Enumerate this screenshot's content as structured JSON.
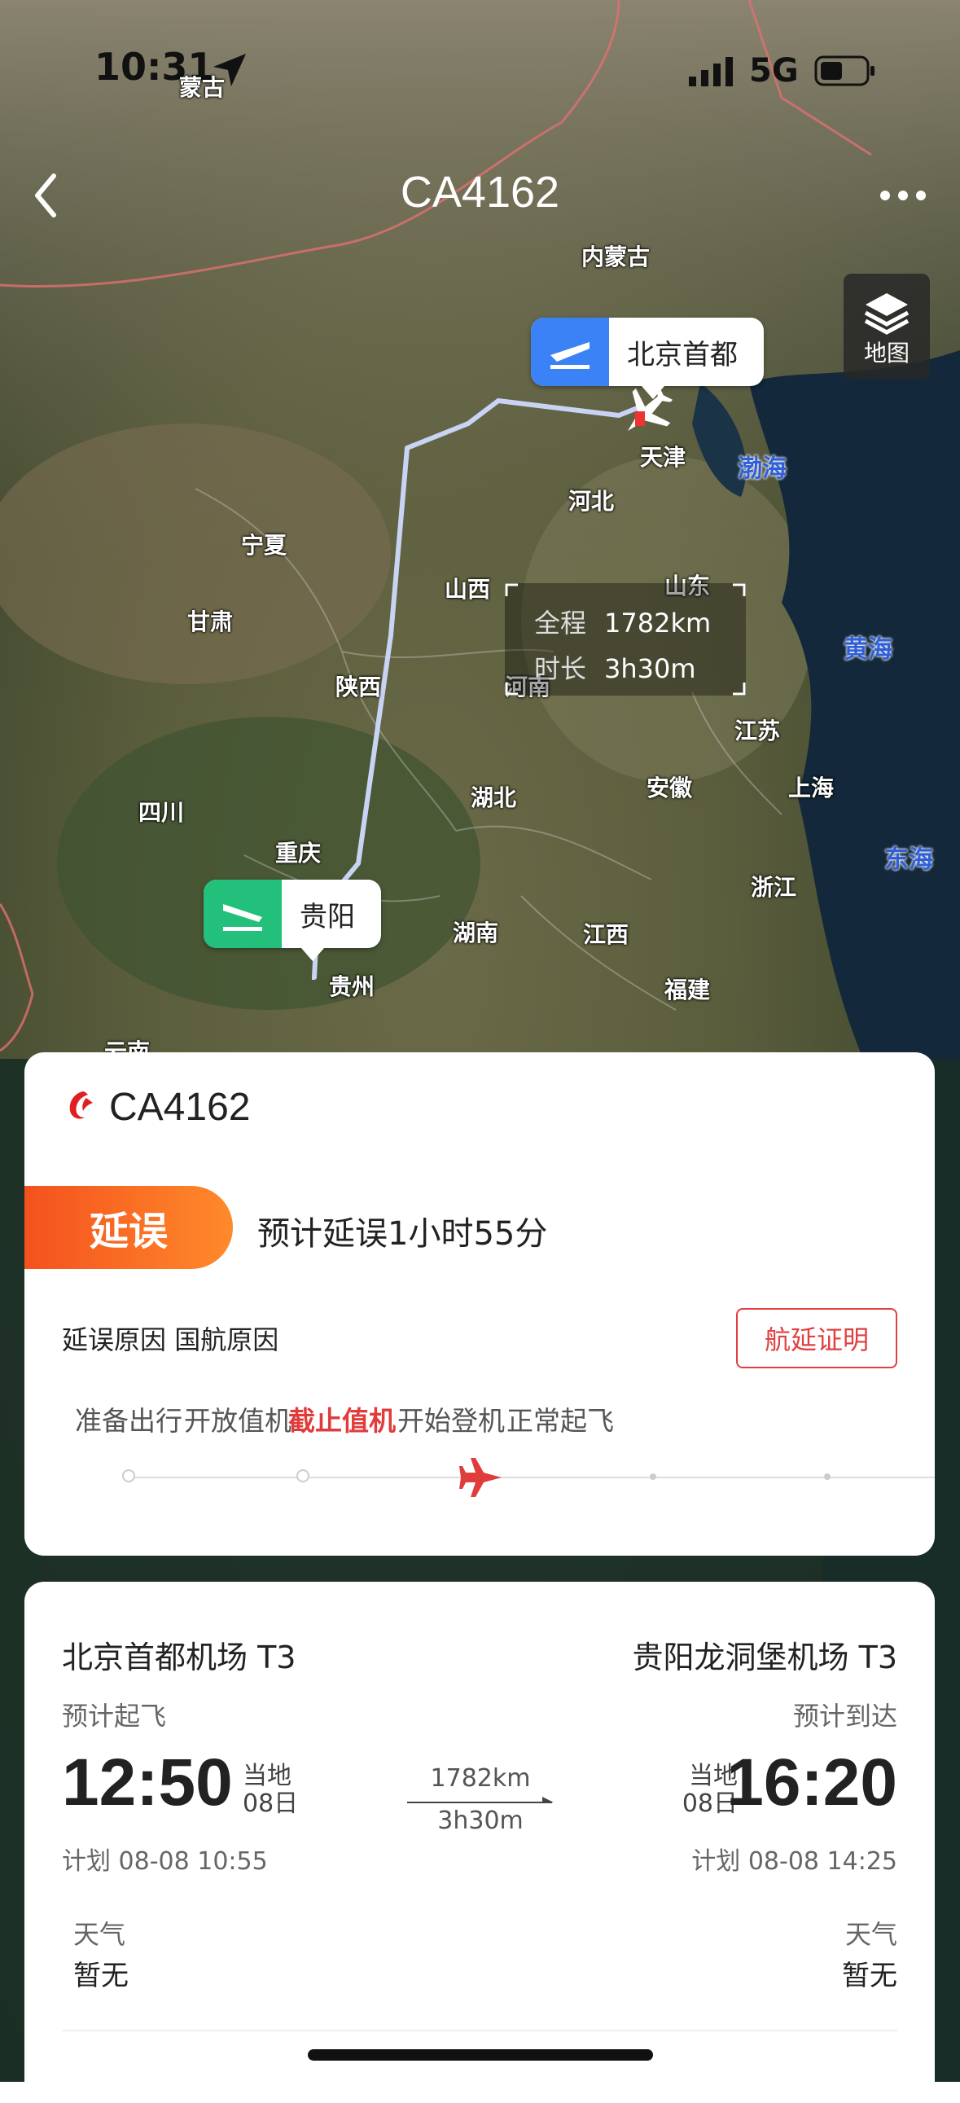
{
  "status_bar": {
    "time": "10:31",
    "network": "5G"
  },
  "header": {
    "title": "CA4162"
  },
  "layers_button": {
    "label": "地图"
  },
  "map": {
    "regions": [
      "蒙古",
      "内蒙古",
      "天津",
      "河北",
      "宁夏",
      "甘肃",
      "山西",
      "山东",
      "陕西",
      "河南",
      "江苏",
      "四川",
      "湖北",
      "安徽",
      "上海",
      "重庆",
      "浙江",
      "湖南",
      "江西",
      "贵州",
      "福建",
      "云南"
    ],
    "seas": [
      "渤海",
      "黄海",
      "东海"
    ],
    "origin_pin": "北京首都",
    "dest_pin": "贵阳",
    "info": {
      "distance_label": "全程",
      "distance": "1782km",
      "duration_label": "时长",
      "duration": "3h30m"
    }
  },
  "status_card": {
    "flight_no": "CA4162",
    "status": "延误",
    "status_detail": "预计延误1小时55分",
    "reason_label": "延误原因",
    "reason": "国航原因",
    "certificate_button": "航延证明",
    "steps": [
      "准备出行",
      "开放值机",
      "截止值机",
      "开始登机",
      "正常起飞"
    ],
    "active_step": 2
  },
  "detail_card": {
    "departure": {
      "airport": "北京首都机场 T3",
      "label": "预计起飞",
      "time": "12:50",
      "local_label": "当地",
      "local_date": "08日",
      "plan": "计划 08-08 10:55",
      "weather_label": "天气",
      "weather": "暂无"
    },
    "arrival": {
      "airport": "贵阳龙洞堡机场 T3",
      "label": "预计到达",
      "time": "16:20",
      "local_label": "当地",
      "local_date": "08日",
      "plan": "计划 08-08 14:25",
      "weather_label": "天气",
      "weather": "暂无"
    },
    "distance": "1782km",
    "duration": "3h30m"
  },
  "colors": {
    "accent_red": "#e03c3c",
    "delay_orange": "#f4511e",
    "origin_blue": "#3b82f6",
    "dest_green": "#22c07a"
  }
}
